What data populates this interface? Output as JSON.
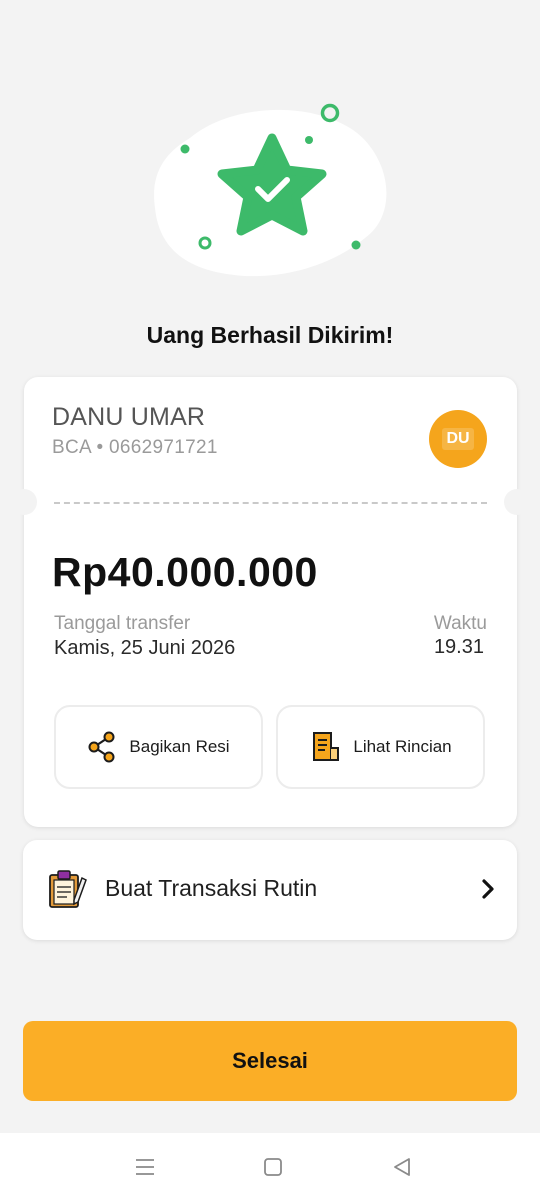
{
  "status": {
    "title": "Uang Berhasil Dikirim!"
  },
  "recipient": {
    "name": "DANU UMAR",
    "account": "BCA • 0662971721",
    "initials": "DU"
  },
  "transfer": {
    "amount": "Rp40.000.000",
    "date_label": "Tanggal transfer",
    "date_value": "Kamis, 25 Juni 2026",
    "time_label": "Waktu",
    "time_value": "19.31"
  },
  "actions": {
    "share_label": "Bagikan Resi",
    "detail_label": "Lihat Rincian"
  },
  "routine": {
    "label": "Buat Transaksi Rutin"
  },
  "footer": {
    "done_label": "Selesai"
  },
  "icons": {
    "success": "star-check-icon",
    "share": "share-icon",
    "detail": "receipt-icon",
    "routine": "clipboard-icon",
    "chevron": "chevron-right-icon",
    "nav": [
      "menu-icon",
      "home-icon",
      "back-icon"
    ]
  },
  "colors": {
    "accent": "#fbae26",
    "success_green": "#3dba6a",
    "avatar": "#f5a51c"
  }
}
